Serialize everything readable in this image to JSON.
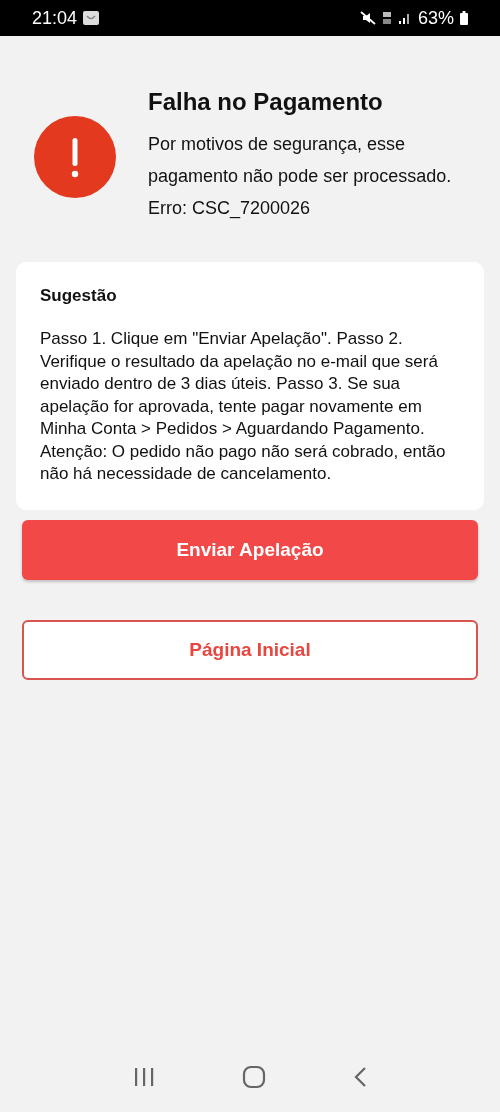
{
  "status_bar": {
    "time": "21:04",
    "battery": "63%"
  },
  "header": {
    "title": "Falha no Pagamento",
    "message": "Por motivos de segurança, esse pagamento não pode ser processado. Erro: CSC_7200026"
  },
  "suggestion": {
    "title": "Sugestão",
    "text": "Passo 1. Clique em \"Enviar Apelação\". Passo 2. Verifique o resultado da apelação no e-mail que será enviado dentro de 3 dias úteis. Passo 3. Se sua apelação for aprovada, tente pagar novamente em Minha Conta > Pedidos > Aguardando Pagamento. Atenção: O pedido não pago não será cobrado, então não há necessidade de cancelamento."
  },
  "buttons": [
    {
      "label": "Enviar Apelação",
      "kind": "primary"
    },
    {
      "label": "Página Inicial",
      "kind": "secondary"
    }
  ]
}
